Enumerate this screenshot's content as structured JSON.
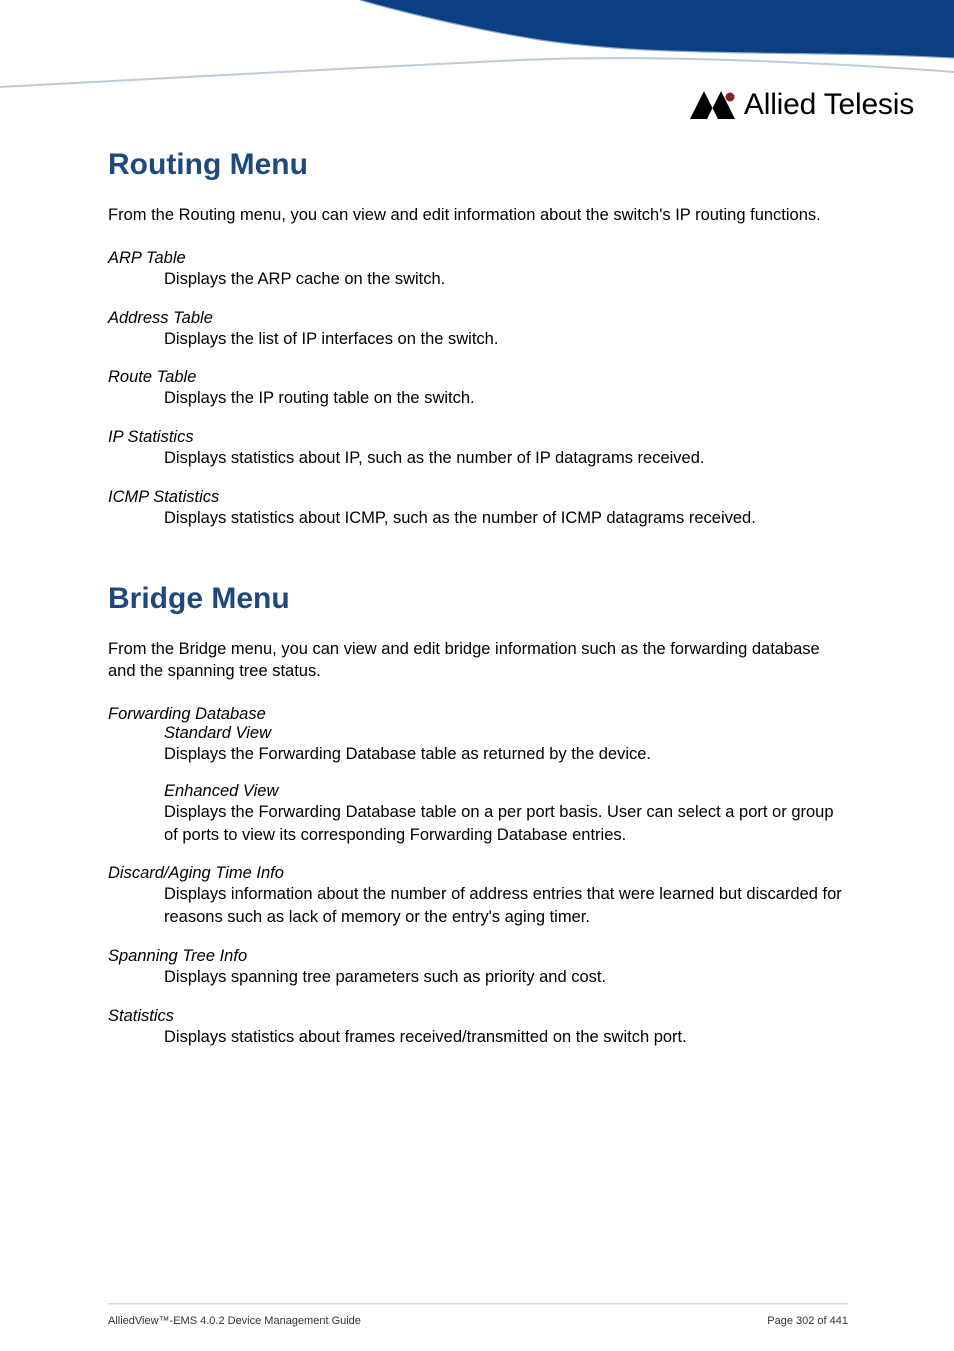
{
  "brand": {
    "name": "Allied Telesis"
  },
  "routing": {
    "heading": "Routing Menu",
    "intro": "From the Routing menu, you can view and edit information about the switch's IP routing functions.",
    "items": [
      {
        "term": "ARP Table",
        "desc": "Displays the ARP cache on the switch."
      },
      {
        "term": "Address Table",
        "desc": "Displays the list of IP interfaces on the switch."
      },
      {
        "term": "Route Table",
        "desc": "Displays the IP routing table on the switch."
      },
      {
        "term": "IP Statistics",
        "desc": "Displays statistics about IP, such as the number of IP datagrams received."
      },
      {
        "term": "ICMP Statistics",
        "desc": "Displays statistics about ICMP, such as the number of ICMP datagrams received."
      }
    ]
  },
  "bridge": {
    "heading": "Bridge Menu",
    "intro": "From the Bridge menu, you can view and edit bridge information such as the forwarding database and the spanning tree status.",
    "fdb": {
      "term": "Forwarding Database",
      "standard": {
        "term": "Standard View",
        "desc": "Displays the Forwarding Database table as returned by the device."
      },
      "enhanced": {
        "term": "Enhanced View",
        "desc": "Displays the Forwarding Database table on a per port basis. User can select a port or group of ports to view its corresponding Forwarding Database entries."
      }
    },
    "discard": {
      "term": "Discard/Aging Time Info",
      "desc": "Displays information about the number of address entries that were learned but discarded for reasons such as lack of memory or the entry's aging timer."
    },
    "spanning": {
      "term": "Spanning Tree Info",
      "desc": "Displays spanning tree parameters such as priority and cost."
    },
    "stats": {
      "term": "Statistics",
      "desc": "Displays statistics about frames received/transmitted on the switch port."
    }
  },
  "footer": {
    "left": "AlliedView™-EMS 4.0.2 Device Management Guide",
    "right": "Page 302 of 441"
  }
}
